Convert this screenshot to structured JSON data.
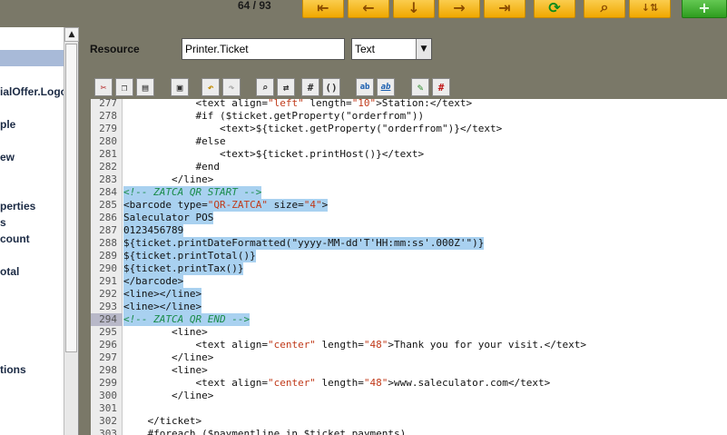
{
  "top_toolbar": {
    "counter": "64 / 93",
    "buttons": [
      "first-icon",
      "previous-icon",
      "down-icon",
      "next-icon",
      "last-icon",
      "refresh-icon",
      "search-icon",
      "sort-icon",
      "add-icon"
    ]
  },
  "sidebar": {
    "items": [
      "ialOffer.Logo",
      "ple",
      "ew",
      "perties",
      "s",
      "count",
      "otal",
      "tions"
    ]
  },
  "resource": {
    "label": "Resource",
    "name_value": "Printer.Ticket",
    "type_value": "Text"
  },
  "editor_toolbar": {
    "buttons": [
      "cut-icon",
      "copy-icon",
      "paste-icon",
      "save-icon",
      "undo-icon",
      "redo-icon",
      "find-icon",
      "replace-icon",
      "hash-icon",
      "brace-icon",
      "ab-icon",
      "ab-italic-icon",
      "tag-icon",
      "clear-icon"
    ]
  },
  "editor": {
    "lines": [
      {
        "n": "277",
        "code": "            <text align=\"left\" length=\"10\">Station:</text>"
      },
      {
        "n": "278",
        "code": "            #if ($ticket.getProperty(\"orderfrom\"))"
      },
      {
        "n": "279",
        "code": "                <text>${ticket.getProperty(\"orderfrom\")}</text>"
      },
      {
        "n": "280",
        "code": "            #else"
      },
      {
        "n": "281",
        "code": "                <text>${ticket.printHost()}</text>"
      },
      {
        "n": "282",
        "code": "            #end"
      },
      {
        "n": "283",
        "code": "        </line>"
      },
      {
        "n": "284",
        "code": "<!-- ZATCA QR START -->"
      },
      {
        "n": "285",
        "code": "<barcode type=\"QR-ZATCA\" size=\"4\">"
      },
      {
        "n": "286",
        "code": "Saleculator POS"
      },
      {
        "n": "287",
        "code": "0123456789"
      },
      {
        "n": "288",
        "code": "${ticket.printDateFormatted(\"yyyy-MM-dd'T'HH:mm:ss'.000Z'\")}"
      },
      {
        "n": "289",
        "code": "${ticket.printTotal()}"
      },
      {
        "n": "290",
        "code": "${ticket.printTax()}"
      },
      {
        "n": "291",
        "code": "</barcode>"
      },
      {
        "n": "292",
        "code": "<line></line>"
      },
      {
        "n": "293",
        "code": "<line></line>"
      },
      {
        "n": "294",
        "code": "<!-- ZATCA QR END -->"
      },
      {
        "n": "295",
        "code": "        <line>"
      },
      {
        "n": "296",
        "code": "            <text align=\"center\" length=\"48\">Thank you for your visit.</text>"
      },
      {
        "n": "297",
        "code": "        </line>"
      },
      {
        "n": "298",
        "code": "        <line>"
      },
      {
        "n": "299",
        "code": "            <text align=\"center\" length=\"48\">www.saleculator.com</text>"
      },
      {
        "n": "300",
        "code": "        </line>"
      },
      {
        "n": "301",
        "code": ""
      },
      {
        "n": "302",
        "code": "    </ticket>"
      },
      {
        "n": "303",
        "code": "    #foreach ($paymentline in $ticket.payments)"
      }
    ],
    "highlighted_from": "284",
    "highlighted_to": "294",
    "current_line": "294"
  }
}
